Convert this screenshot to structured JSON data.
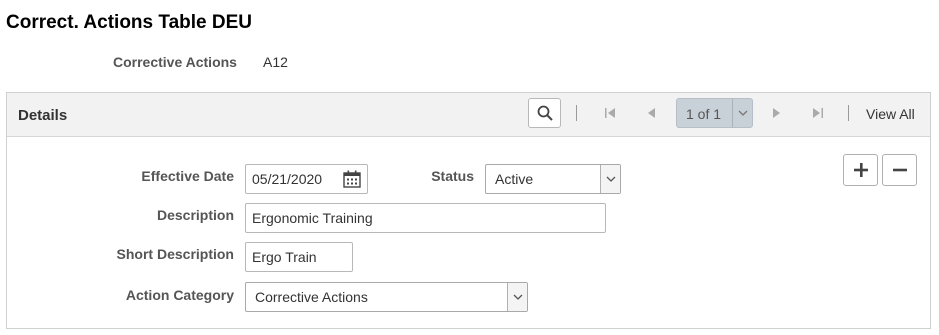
{
  "page": {
    "title": "Correct. Actions Table DEU"
  },
  "key": {
    "label": "Corrective Actions",
    "value": "A12"
  },
  "details": {
    "title": "Details",
    "pager": {
      "text": "1 of 1"
    },
    "view_all": "View All"
  },
  "form": {
    "effective_date": {
      "label": "Effective Date",
      "value": "05/21/2020"
    },
    "status": {
      "label": "Status",
      "value": "Active"
    },
    "description": {
      "label": "Description",
      "value": "Ergonomic Training"
    },
    "short_description": {
      "label": "Short Description",
      "value": "Ergo Train"
    },
    "action_category": {
      "label": "Action Category",
      "value": "Corrective Actions"
    }
  }
}
